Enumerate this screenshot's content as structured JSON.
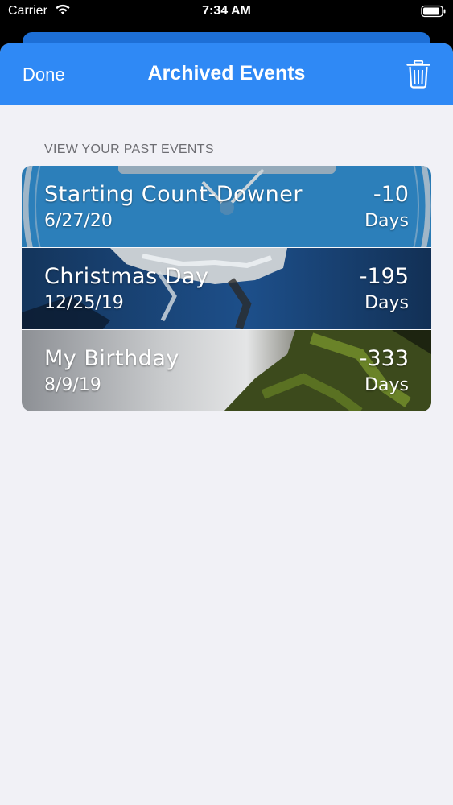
{
  "status_bar": {
    "carrier": "Carrier",
    "time": "7:34 AM",
    "wifi_icon": "wifi-icon",
    "battery_icon": "battery-icon"
  },
  "nav": {
    "done_label": "Done",
    "title": "Archived Events",
    "trash_icon": "trash-icon",
    "background_color": "#2f89f5"
  },
  "section": {
    "header": "VIEW YOUR PAST EVENTS"
  },
  "events": [
    {
      "name": "Starting Count-Downer",
      "date": "6/27/20",
      "count": "-10",
      "unit": "Days",
      "image": "clock-face"
    },
    {
      "name": "Christmas Day",
      "date": "12/25/19",
      "count": "-195",
      "unit": "Days",
      "image": "snowy-branches"
    },
    {
      "name": "My Birthday",
      "date": "8/9/19",
      "count": "-333",
      "unit": "Days",
      "image": "waterfall"
    }
  ]
}
